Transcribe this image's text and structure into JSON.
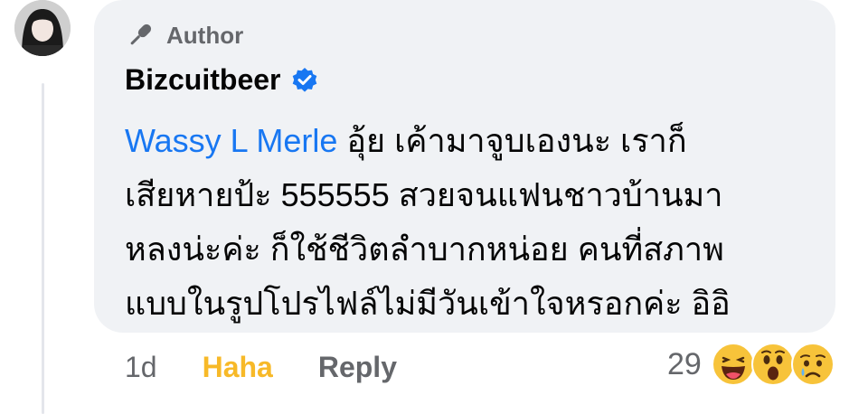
{
  "comment": {
    "badge": {
      "label": "Author",
      "icon": "microphone-icon"
    },
    "author_name": "Bizcuitbeer",
    "verified_icon": "verified-check-icon",
    "mention": "Wassy L Merle",
    "body_lines": [
      " อุ้ย เค้ามาจูบเองนะ เราก็",
      "เสียหายป้ะ 555555 สวยจนแฟนชาวบ้านมา",
      "หลงน่ะค่ะ ก็ใช้ชีวิตลำบากหน่อย คนที่สภาพ",
      "แบบในรูปโปรไฟล์ไม่มีวันเข้าใจหรอกค่ะ อิอิ"
    ]
  },
  "footer": {
    "time": "1d",
    "reaction_label": "Haha",
    "reply_label": "Reply",
    "reaction_count": "29",
    "reaction_icons": [
      "haha-emoji-icon",
      "wow-emoji-icon",
      "sad-emoji-icon"
    ]
  },
  "colors": {
    "bubble": "#f0f2f5",
    "mention": "#1877f2",
    "haha": "#f7b928",
    "secondary_text": "#65676b",
    "verified": "#1877f2"
  }
}
